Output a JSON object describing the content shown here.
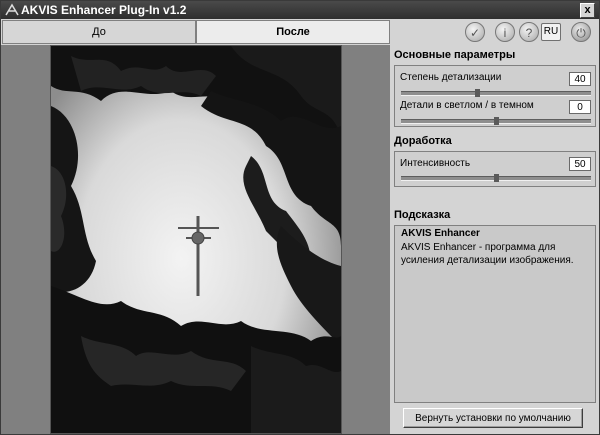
{
  "titlebar": {
    "title": "AKVIS Enhancer Plug-In v1.2",
    "close": "x"
  },
  "tabs": {
    "before": "До",
    "after": "После"
  },
  "toolbar": {
    "lang": "RU"
  },
  "panel": {
    "basic_title": "Основные параметры",
    "params": [
      {
        "label": "Степень детализации",
        "value": "40",
        "level": 0.4
      },
      {
        "label": "Детали в светлом / в темном",
        "value": "0",
        "level": 0.5
      }
    ],
    "refine_title": "Доработка",
    "intensity": {
      "label": "Интенсивность",
      "value": "50",
      "level": 0.5
    },
    "hint_title": "Подсказка",
    "hint_heading": "AKVIS Enhancer",
    "hint_text": "AKVIS Enhancer - программа для усиления детализации изображения.",
    "reset_label": "Вернуть установки по умолчанию"
  }
}
